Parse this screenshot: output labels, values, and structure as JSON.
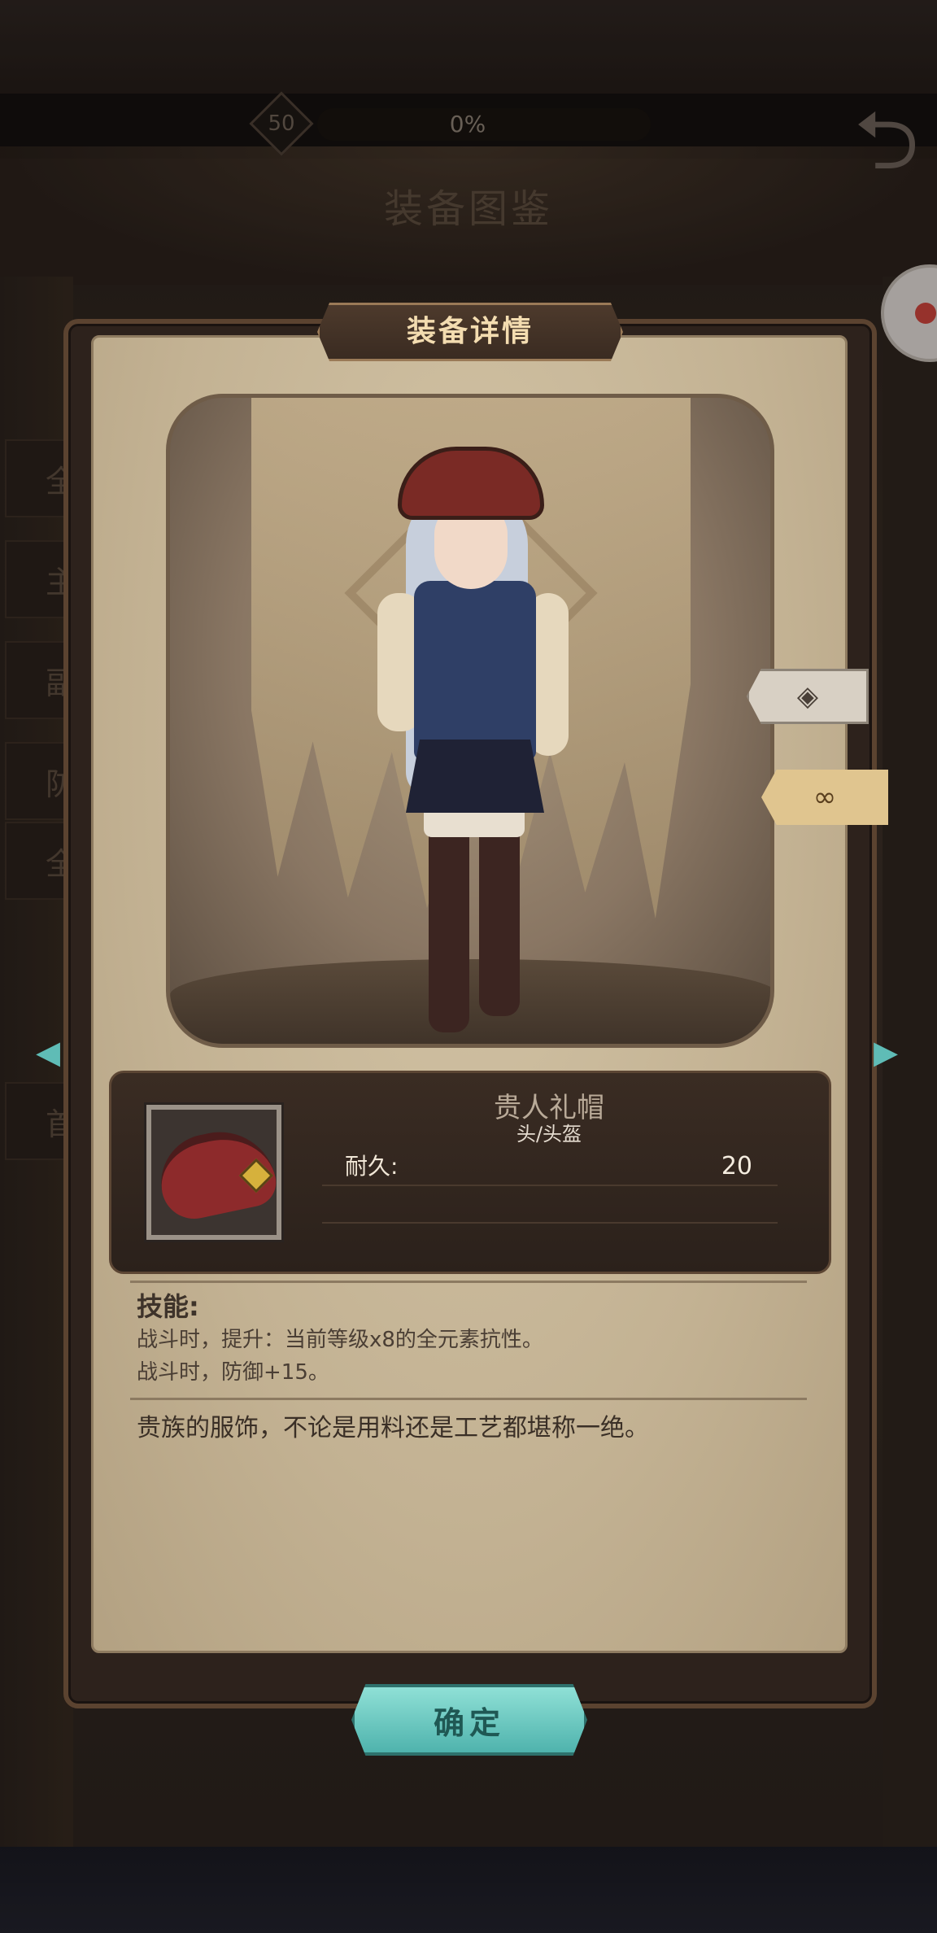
{
  "hud": {
    "level": "50",
    "progress_text": "0%"
  },
  "codex_title": "装备图鉴",
  "background_tabs": [
    "全",
    "主",
    "副",
    "防",
    "全",
    "首"
  ],
  "modal": {
    "title": "装备详情",
    "item": {
      "name": "贵人礼帽",
      "slot": "头/头盔",
      "stats": [
        {
          "label": "耐久:",
          "value": "20"
        }
      ]
    },
    "skills": {
      "heading": "技能:",
      "lines": [
        "战斗时，提升：当前等级x8的全元素抗性。",
        "战斗时，防御+15。"
      ]
    },
    "description": "贵族的服饰，不论是用料还是工艺都堪称一绝。",
    "confirm_label": "确定"
  },
  "side_tabs": [
    {
      "icon": "cracked-diamond-icon",
      "state": "inactive"
    },
    {
      "icon": "infinity-diamond-icon",
      "state": "active"
    }
  ],
  "colors": {
    "accent_teal": "#5fbcb6",
    "parchment": "#c3b293",
    "panel_dark": "#2b211b",
    "tab_active": "#e0c58f"
  }
}
